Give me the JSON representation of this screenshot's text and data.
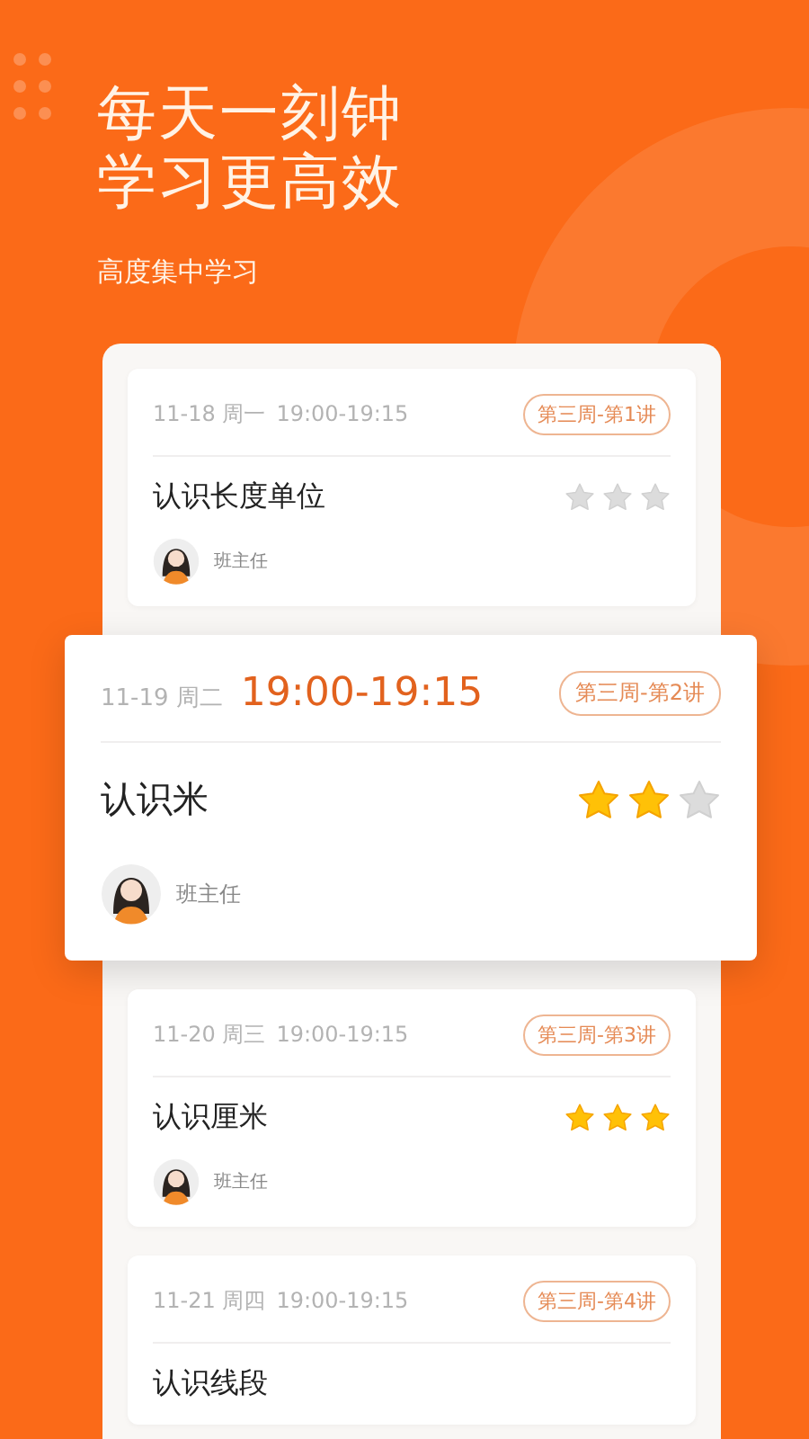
{
  "header": {
    "title_lines": [
      "每天一刻钟",
      "学习更高效"
    ],
    "subtitle": "高度集中学习"
  },
  "cards": [
    {
      "date": "11-18 周一",
      "time": "19:00-19:15",
      "tag": "第三周-第1讲",
      "title": "认识长度单位",
      "stars": 0,
      "teacher": "班主任",
      "selected": false
    },
    {
      "date": "11-19 周二",
      "time": "19:00-19:15",
      "tag": "第三周-第2讲",
      "title": "认识米",
      "stars": 2,
      "teacher": "班主任",
      "selected": true
    },
    {
      "date": "11-20 周三",
      "time": "19:00-19:15",
      "tag": "第三周-第3讲",
      "title": "认识厘米",
      "stars": 3,
      "teacher": "班主任",
      "selected": false
    },
    {
      "date": "11-21 周四",
      "time": "19:00-19:15",
      "tag": "第三周-第4讲",
      "title": "认识线段",
      "selected": false
    }
  ]
}
